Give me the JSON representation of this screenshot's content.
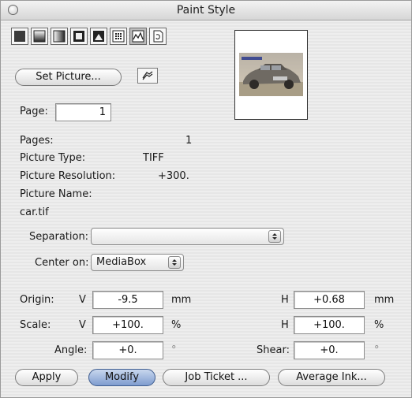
{
  "window": {
    "title": "Paint Style"
  },
  "toolbar": {
    "modes": [
      {
        "icon": "solid-fill-icon"
      },
      {
        "icon": "linear-gradient-icon"
      },
      {
        "icon": "horizontal-gradient-icon"
      },
      {
        "icon": "rectangular-gradient-icon"
      },
      {
        "icon": "radial-gradient-icon"
      },
      {
        "icon": "pattern-fill-icon"
      },
      {
        "icon": "picture-fill-icon",
        "active": true
      },
      {
        "icon": "page-curl-icon"
      }
    ]
  },
  "picture": {
    "set_picture_label": "Set Picture...",
    "swap_icon": "swap-icon",
    "preview_caption": "tiff image"
  },
  "page": {
    "label": "Page:",
    "value": "1"
  },
  "info": {
    "pages_label": "Pages:",
    "pages_value": "1",
    "type_label": "Picture Type:",
    "type_value": "TIFF",
    "resolution_label": "Picture Resolution:",
    "resolution_value": "+300.",
    "name_label": "Picture Name:",
    "name_value": "car.tif"
  },
  "separation": {
    "label": "Separation:",
    "value": ""
  },
  "center_on": {
    "label": "Center on:",
    "value": "MediaBox"
  },
  "origin": {
    "label": "Origin:",
    "v_label": "V",
    "v_value": "-9.5",
    "v_unit": "mm",
    "h_label": "H",
    "h_value": "+0.68",
    "h_unit": "mm"
  },
  "scale": {
    "label": "Scale:",
    "v_label": "V",
    "v_value": "+100.",
    "v_unit": "%",
    "h_label": "H",
    "h_value": "+100.",
    "h_unit": "%"
  },
  "angle": {
    "label": "Angle:",
    "value": "+0.",
    "unit": "°"
  },
  "shear": {
    "label": "Shear:",
    "value": "+0.",
    "unit": "°"
  },
  "buttons": {
    "apply": "Apply",
    "modify": "Modify",
    "job_ticket": "Job Ticket ...",
    "average_ink": "Average Ink..."
  }
}
